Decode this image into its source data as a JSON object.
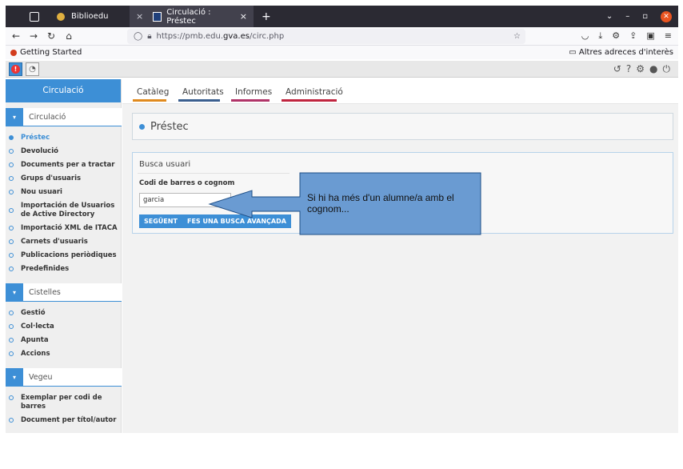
{
  "browser": {
    "tabs": [
      {
        "label": "Biblioedu",
        "active": false
      },
      {
        "label": "Circulació : Préstec",
        "active": true
      }
    ],
    "new_tab": "+",
    "url_prefix": "https://pmb.edu.",
    "url_host": "gva.es",
    "url_path": "/circ.php",
    "bookmarks": {
      "left": "Getting Started",
      "right": "Altres adreces d'interès"
    },
    "close_glyph": "×"
  },
  "pmb_toolbar": {
    "alert_glyph": "!",
    "dash_glyph": "◔",
    "right_icons": [
      "history-icon",
      "help-icon",
      "gear-icon",
      "globe-icon",
      "power-icon"
    ]
  },
  "sidebar": {
    "header": "Circulació",
    "sections": [
      {
        "title": "Circulació",
        "items": [
          "Préstec",
          "Devolució",
          "Documents per a tractar",
          "Grups d'usuaris",
          "Nou usuari",
          "Importación de Usuarios de Active Directory",
          "Importació XML de ITACA",
          "Carnets d'usuaris",
          "Publicacions periòdiques",
          "Predefinides"
        ]
      },
      {
        "title": "Cistelles",
        "items": [
          "Gestió",
          "Col·lecta",
          "Apunta",
          "Accions"
        ]
      },
      {
        "title": "Vegeu",
        "items": [
          "Exemplar per codi de barres",
          "Document per títol/autor"
        ]
      }
    ]
  },
  "main": {
    "tabs": [
      {
        "label": "Catàleg",
        "color": "#e08a1e"
      },
      {
        "label": "Autoritats",
        "color": "#3b5f8f"
      },
      {
        "label": "Informes",
        "color": "#b03468"
      },
      {
        "label": "Administració",
        "color": "#c0253f"
      }
    ],
    "page_title": "Préstec",
    "search": {
      "heading": "Busca usuari",
      "field_label": "Codi de barres o cognom",
      "field_value": "garcia",
      "next_button": "SEGÜENT",
      "advanced_button": "FES UNA BUSCA AVANÇADA"
    }
  },
  "callout": {
    "text": "Si hi ha més d'un alumne/a amb el cognom...",
    "fill": "#6a9bd2",
    "border": "#1f4f87"
  }
}
